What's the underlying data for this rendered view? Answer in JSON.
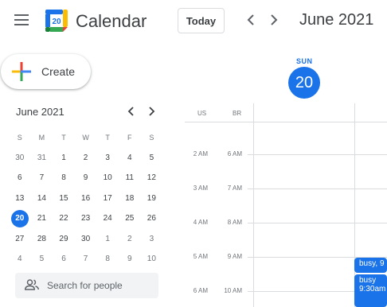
{
  "header": {
    "app_title": "Calendar",
    "logo_day": "20",
    "today_label": "Today",
    "prev_icon": "chevron-left-icon",
    "next_icon": "chevron-right-icon",
    "period_title": "June 2021"
  },
  "create": {
    "label": "Create"
  },
  "mini_calendar": {
    "title": "June 2021",
    "weekdays": [
      "S",
      "M",
      "T",
      "W",
      "T",
      "F",
      "S"
    ],
    "weeks": [
      [
        "30",
        "31",
        "1",
        "2",
        "3",
        "4",
        "5"
      ],
      [
        "6",
        "7",
        "8",
        "9",
        "10",
        "11",
        "12"
      ],
      [
        "13",
        "14",
        "15",
        "16",
        "17",
        "18",
        "19"
      ],
      [
        "20",
        "21",
        "22",
        "23",
        "24",
        "25",
        "26"
      ],
      [
        "27",
        "28",
        "29",
        "30",
        "1",
        "2",
        "3"
      ],
      [
        "4",
        "5",
        "6",
        "7",
        "8",
        "9",
        "10"
      ]
    ],
    "selected": "20"
  },
  "people_search": {
    "placeholder": "Search for people"
  },
  "day_header": {
    "name": "SUN",
    "number": "20"
  },
  "timezones": [
    "US",
    "BR"
  ],
  "time_rows": [
    {
      "us": "2 AM",
      "br": "6 AM"
    },
    {
      "us": "3 AM",
      "br": "7 AM"
    },
    {
      "us": "4 AM",
      "br": "8 AM"
    },
    {
      "us": "5 AM",
      "br": "9 AM"
    },
    {
      "us": "6 AM",
      "br": "10 AM"
    }
  ],
  "events": [
    {
      "title": "busy, 9",
      "time": ""
    },
    {
      "title": "busy",
      "time": "9:30am"
    }
  ],
  "colors": {
    "accent": "#1a73e8"
  }
}
